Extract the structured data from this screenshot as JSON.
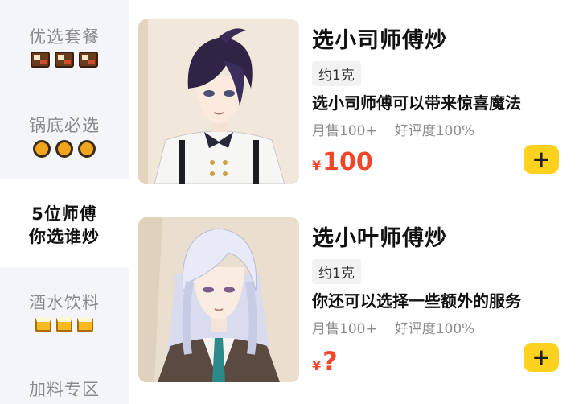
{
  "sidebar": {
    "categories": [
      {
        "label": "优选套餐",
        "icon": "bento-box-icon",
        "active": false
      },
      {
        "label": "锅底必选",
        "icon": "hotpot-icon",
        "active": false
      },
      {
        "label_line1": "5位师傅",
        "label_line2": "你选谁炒",
        "active": true
      },
      {
        "label": "酒水饮料",
        "icon": "beer-mug-icon",
        "active": false
      },
      {
        "label": "加料专区",
        "icon": "leaf-icon",
        "active": false
      }
    ]
  },
  "items": [
    {
      "title": "选小司师傅炒",
      "weight": "约1克",
      "description": "选小司师傅可以带来惊喜魔法",
      "monthly_sales": "月售100+",
      "rating": "好评度100%",
      "currency": "¥",
      "price": "100",
      "image": "dark-haired-anime-man-illustration"
    },
    {
      "title": "选小叶师傅炒",
      "weight": "约1克",
      "description": "你还可以选择一些额外的服务",
      "monthly_sales": "月售100+",
      "rating": "好评度100%",
      "currency": "¥",
      "price": "?",
      "image": "silver-haired-anime-man-illustration"
    }
  ],
  "colors": {
    "accent_price": "#f0462a",
    "add_button": "#ffd21f",
    "sidebar_bg": "#f3f5f8"
  }
}
